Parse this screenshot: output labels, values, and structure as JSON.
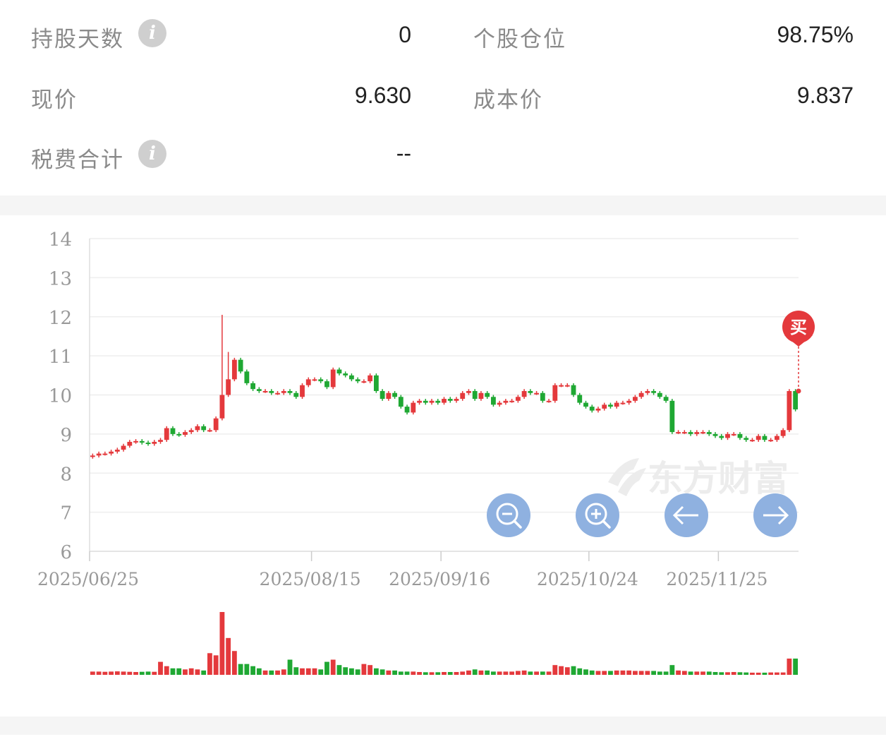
{
  "stats": {
    "holding_days_label": "持股天数",
    "holding_days_value": "0",
    "position_label": "个股仓位",
    "position_value": "98.75%",
    "price_label": "现价",
    "price_value": "9.630",
    "cost_label": "成本价",
    "cost_value": "9.837",
    "fees_label": "税费合计",
    "fees_value": "--"
  },
  "icons": {
    "info": "i",
    "buy": "买"
  },
  "colors": {
    "up": "#e4393c",
    "down": "#1fa833",
    "grid": "#eeeeee",
    "axis_text": "#999999",
    "control": "#8fb1e0"
  },
  "chart_data": {
    "type": "candlestick",
    "watermark": "东方财富",
    "buy_marker": "买",
    "y_ticks": [
      "14",
      "13",
      "12",
      "11",
      "10",
      "9",
      "8",
      "7",
      "6"
    ],
    "ylim": [
      6,
      14
    ],
    "x_tick_labels": [
      "2025/06/25",
      "2025/08/15",
      "2025/09/16",
      "2025/10/24",
      "2025/11/25"
    ],
    "closes": [
      8.45,
      8.5,
      8.5,
      8.55,
      8.6,
      8.7,
      8.8,
      8.82,
      8.78,
      8.75,
      8.8,
      8.85,
      9.15,
      9.0,
      8.98,
      9.05,
      9.1,
      9.2,
      9.1,
      9.1,
      9.4,
      10.0,
      10.4,
      10.9,
      10.6,
      10.3,
      10.15,
      10.1,
      10.1,
      10.05,
      10.05,
      10.1,
      10.05,
      9.95,
      10.25,
      10.4,
      10.4,
      10.35,
      10.2,
      10.65,
      10.55,
      10.5,
      10.4,
      10.35,
      10.35,
      10.5,
      10.1,
      9.9,
      10.05,
      9.95,
      9.7,
      9.55,
      9.8,
      9.85,
      9.8,
      9.85,
      9.8,
      9.9,
      9.85,
      9.9,
      10.05,
      10.1,
      9.9,
      10.05,
      9.95,
      9.75,
      9.8,
      9.85,
      9.85,
      9.95,
      10.1,
      10.05,
      10.05,
      9.85,
      9.85,
      10.25,
      10.25,
      10.25,
      10.0,
      9.8,
      9.7,
      9.6,
      9.65,
      9.75,
      9.7,
      9.8,
      9.8,
      9.85,
      9.95,
      10.05,
      10.1,
      10.05,
      9.95,
      9.85,
      9.05,
      9.05,
      9.05,
      9.0,
      9.05,
      9.05,
      9.0,
      8.95,
      8.9,
      9.0,
      9.0,
      8.9,
      8.85,
      8.85,
      8.95,
      8.85,
      8.85,
      8.95,
      9.1,
      10.1,
      9.63
    ],
    "volumes": [
      1.5,
      1.5,
      1.4,
      1.5,
      1.6,
      1.5,
      1.4,
      1.3,
      1.4,
      1.5,
      1.4,
      6.0,
      4.0,
      3.0,
      3.0,
      2.5,
      3.0,
      2.5,
      2.0,
      10.0,
      9.0,
      29.0,
      17.0,
      11.0,
      5.0,
      5.0,
      4.0,
      3.0,
      2.0,
      2.0,
      2.0,
      2.5,
      7.0,
      3.5,
      3.0,
      3.0,
      3.0,
      2.5,
      6.0,
      7.0,
      4.5,
      3.5,
      3.0,
      2.5,
      5.0,
      4.5,
      3.0,
      2.5,
      2.0,
      2.0,
      1.5,
      1.5,
      1.5,
      1.3,
      1.2,
      1.2,
      1.2,
      1.3,
      1.3,
      1.3,
      1.5,
      2.0,
      2.5,
      2.0,
      2.0,
      1.5,
      1.5,
      1.5,
      1.5,
      1.8,
      2.0,
      1.5,
      1.5,
      1.5,
      1.5,
      4.5,
      4.0,
      3.5,
      4.0,
      3.0,
      2.5,
      2.0,
      1.8,
      1.8,
      1.8,
      2.0,
      2.0,
      2.0,
      1.8,
      1.8,
      1.8,
      1.8,
      1.5,
      1.5,
      4.5,
      2.0,
      1.8,
      1.5,
      1.5,
      1.5,
      1.5,
      1.3,
      1.2,
      1.2,
      1.3,
      1.2,
      1.1,
      1.0,
      1.0,
      1.0,
      1.1,
      1.1,
      1.1,
      7.5,
      7.5
    ]
  }
}
